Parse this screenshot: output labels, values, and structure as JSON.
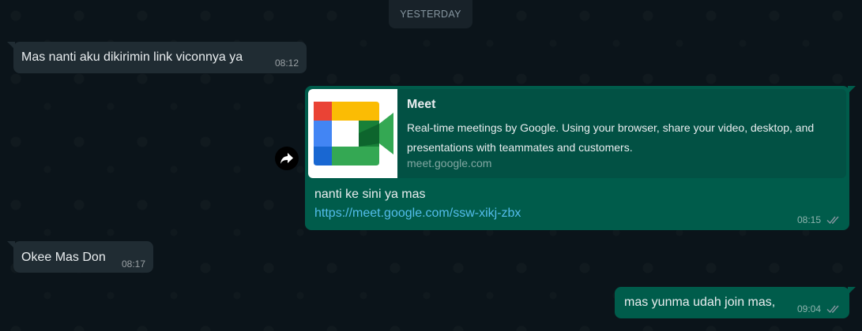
{
  "date_separator": "YESTERDAY",
  "messages": [
    {
      "text": "Mas nanti aku dikirimin link viconnya ya",
      "time": "08:12"
    },
    {
      "preview": {
        "title": "Meet",
        "description": "Real-time meetings by Google. Using your browser, share your video, desktop, and presentations with teammates and customers.",
        "host": "meet.google.com",
        "thumbnail_icon": "google-meet-logo"
      },
      "text": "nanti ke sini ya mas",
      "link": "https://meet.google.com/ssw-xikj-zbx",
      "time": "08:15"
    },
    {
      "text": "Okee Mas Don",
      "time": "08:17"
    },
    {
      "text": "mas yunma udah join mas,",
      "time": "09:04"
    }
  ],
  "colors": {
    "incoming_bubble": "#202c33",
    "outgoing_bubble": "#005c4b",
    "link": "#53bdeb",
    "read_ticks": "#8696a0"
  },
  "icons": {
    "forward": "forward-arrow-icon",
    "status": "double-check-icon"
  }
}
